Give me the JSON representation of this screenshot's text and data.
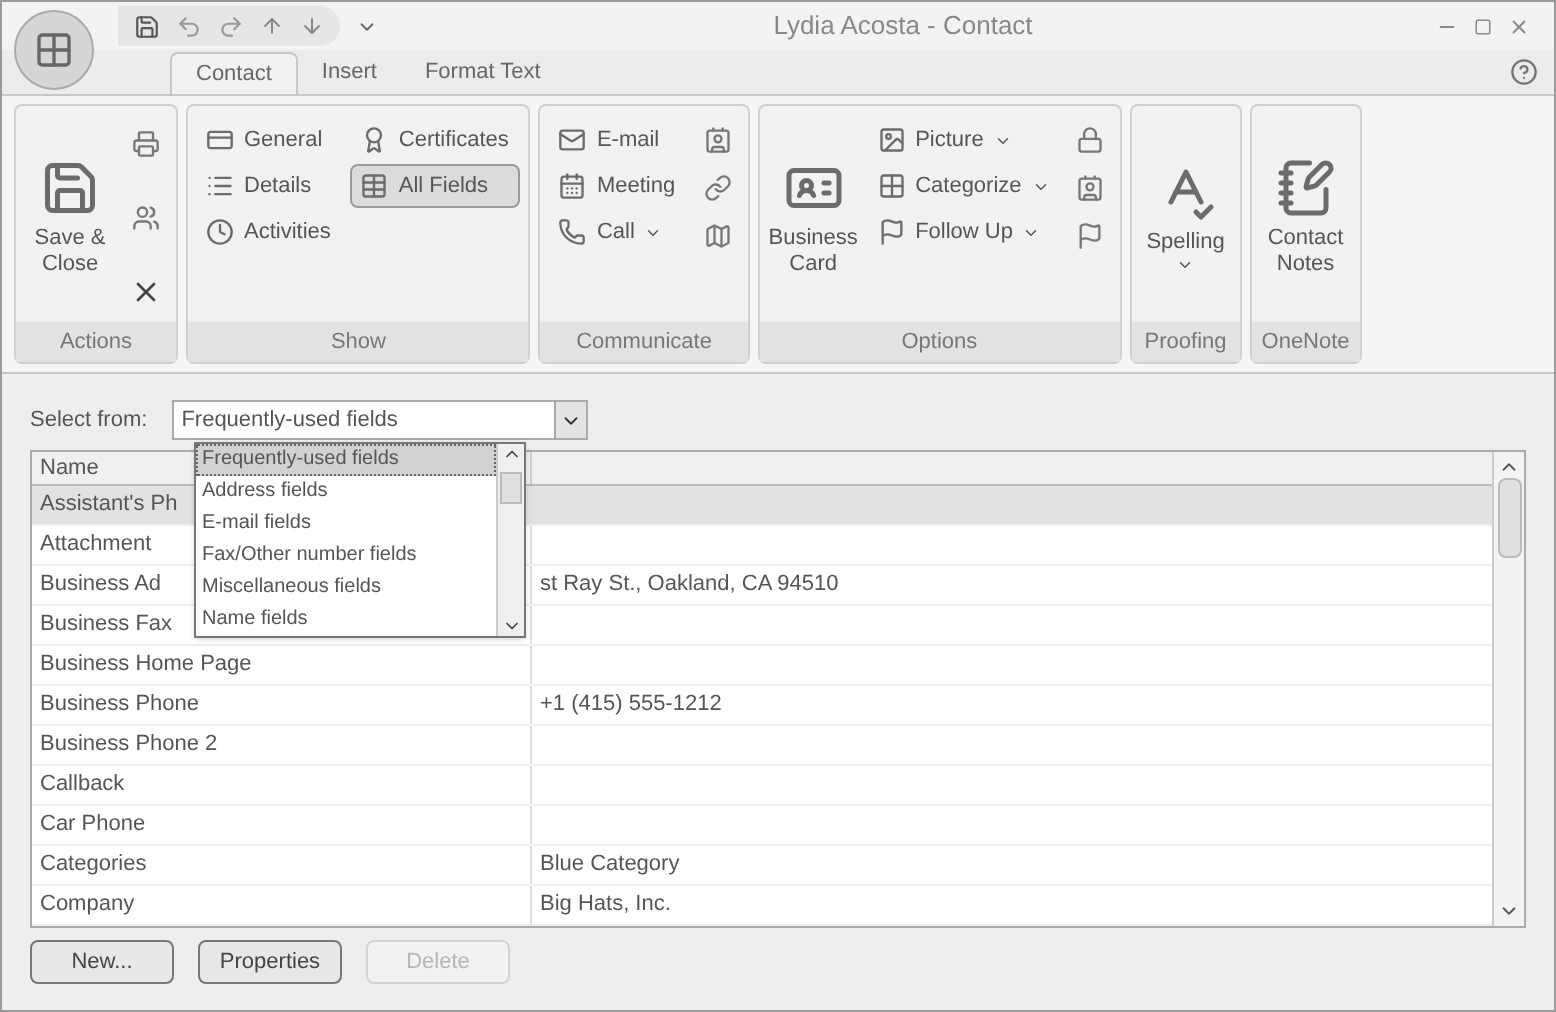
{
  "window": {
    "title": "Lydia Acosta - Contact"
  },
  "tabs": [
    {
      "label": "Contact",
      "selected": true
    },
    {
      "label": "Insert",
      "selected": false
    },
    {
      "label": "Format Text",
      "selected": false
    }
  ],
  "ribbon": [
    {
      "label": "Actions",
      "items": [
        {
          "kind": "large",
          "label": "Save & Close"
        }
      ]
    },
    {
      "label": "Show",
      "items": [
        {
          "kind": "small",
          "label": "General",
          "selected": false
        },
        {
          "kind": "small",
          "label": "Details",
          "selected": false
        },
        {
          "kind": "small",
          "label": "Activities",
          "selected": false
        },
        {
          "kind": "small",
          "label": "Certificates",
          "selected": false
        },
        {
          "kind": "small",
          "label": "All Fields",
          "selected": true
        }
      ]
    },
    {
      "label": "Communicate",
      "items": [
        {
          "kind": "small",
          "label": "E-mail",
          "menu": false
        },
        {
          "kind": "small",
          "label": "Meeting",
          "menu": false
        },
        {
          "kind": "small",
          "label": "Call",
          "menu": true
        }
      ]
    },
    {
      "label": "Options",
      "items": [
        {
          "kind": "large",
          "label": "Business Card",
          "menu": false
        },
        {
          "kind": "small",
          "label": "Picture",
          "menu": true
        },
        {
          "kind": "small",
          "label": "Categorize",
          "menu": true
        },
        {
          "kind": "small",
          "label": "Follow Up",
          "menu": true
        }
      ]
    },
    {
      "label": "Proofing",
      "items": [
        {
          "kind": "large",
          "label": "Spelling",
          "menu": true
        }
      ]
    },
    {
      "label": "OneNote",
      "items": [
        {
          "kind": "large",
          "label": "Contact Notes",
          "menu": false
        }
      ]
    }
  ],
  "select": {
    "label": "Select from:",
    "value": "Frequently-used fields",
    "open": true,
    "options": [
      {
        "label": "Frequently-used fields",
        "selected": true
      },
      {
        "label": "Address fields",
        "selected": false
      },
      {
        "label": "E-mail fields",
        "selected": false
      },
      {
        "label": "Fax/Other number fields",
        "selected": false
      },
      {
        "label": "Miscellaneous fields",
        "selected": false
      },
      {
        "label": "Name fields",
        "selected": false
      }
    ]
  },
  "table": {
    "columns": [
      "Name"
    ],
    "rows": [
      {
        "name": "Assistant's Ph",
        "selected": true
      },
      {
        "name": "Attachment",
        "selected": false
      },
      {
        "name": "Business Ad",
        "value": "st Ray St., Oakland, CA 94510",
        "selected": false
      },
      {
        "name": "Business Fax",
        "selected": false
      },
      {
        "name": "Business Home Page",
        "selected": false
      },
      {
        "name": "Business Phone",
        "value": "+1 (415) 555-1212",
        "selected": false
      },
      {
        "name": "Business Phone 2",
        "selected": false
      },
      {
        "name": "Callback",
        "selected": false
      },
      {
        "name": "Car Phone",
        "selected": false
      },
      {
        "name": "Categories",
        "value": "Blue Category",
        "selected": false
      },
      {
        "name": "Company",
        "value": "Big Hats, Inc.",
        "selected": false
      }
    ]
  },
  "buttons": [
    {
      "label": "New...",
      "disabled": false
    },
    {
      "label": "Properties",
      "disabled": false
    },
    {
      "label": "Delete",
      "disabled": true
    }
  ]
}
